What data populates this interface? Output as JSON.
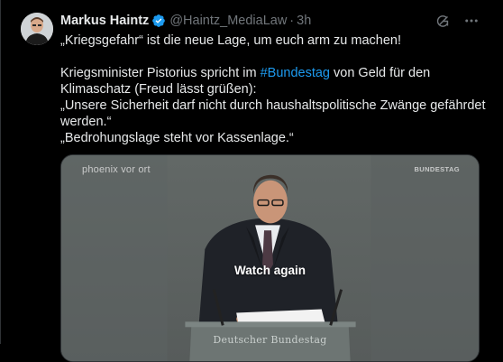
{
  "post": {
    "display_name": "Markus Haintz",
    "handle": "@Haintz_MediaLaw",
    "separator": "·",
    "time": "3h",
    "lines": {
      "l1": "„Kriegsgefahr“ ist die neue Lage, um euch arm zu machen!",
      "l2_pre": "Kriegsminister Pistorius spricht im ",
      "l2_tag": "#Bundestag",
      "l2_post": " von Geld für den",
      "l3": "Klimaschatz (Freud lässt grüßen):",
      "l4": "„Unsere Sicherheit darf nicht durch haushaltspolitische Zwänge gefährdet",
      "l5": "werden.“",
      "l6": "„Bedrohungslage steht vor Kassenlage.“"
    }
  },
  "media": {
    "watermark_left": "phoenix vor ort",
    "watermark_right": "BUNDESTAG",
    "overlay_label": "Watch again",
    "lectern_text": "Deutscher Bundestag"
  },
  "colors": {
    "background": "#000000",
    "text": "#e7e9ea",
    "secondary": "#71767b",
    "link": "#1d9bf0",
    "verified": "#1d9bf0"
  },
  "icons": {
    "verified": "verified-badge-icon",
    "grok": "grok-icon",
    "more": "more-horizontal-icon"
  }
}
